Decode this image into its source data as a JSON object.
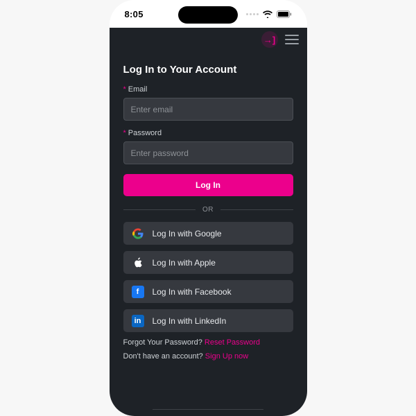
{
  "status": {
    "time": "8:05"
  },
  "header": {
    "login_icon_glyph": "→]"
  },
  "page": {
    "title": "Log In to Your Account",
    "email_label": "Email",
    "email_placeholder": "Enter email",
    "password_label": "Password",
    "password_placeholder": "Enter password",
    "submit_label": "Log In",
    "divider_label": "OR",
    "social": {
      "google": "Log In with Google",
      "apple": "Log In with Apple",
      "facebook": "Log In with Facebook",
      "linkedin": "Log In with LinkedIn",
      "google_glyph": "G",
      "facebook_glyph": "f",
      "linkedin_glyph": "in"
    },
    "forgot_prompt": "Forgot Your Password? ",
    "forgot_link": "Reset Password",
    "signup_prompt": "Don't have an account? ",
    "signup_link": "Sign Up now"
  },
  "colors": {
    "accent": "#ec008c",
    "surface": "#1e2227",
    "field": "#36393f"
  }
}
